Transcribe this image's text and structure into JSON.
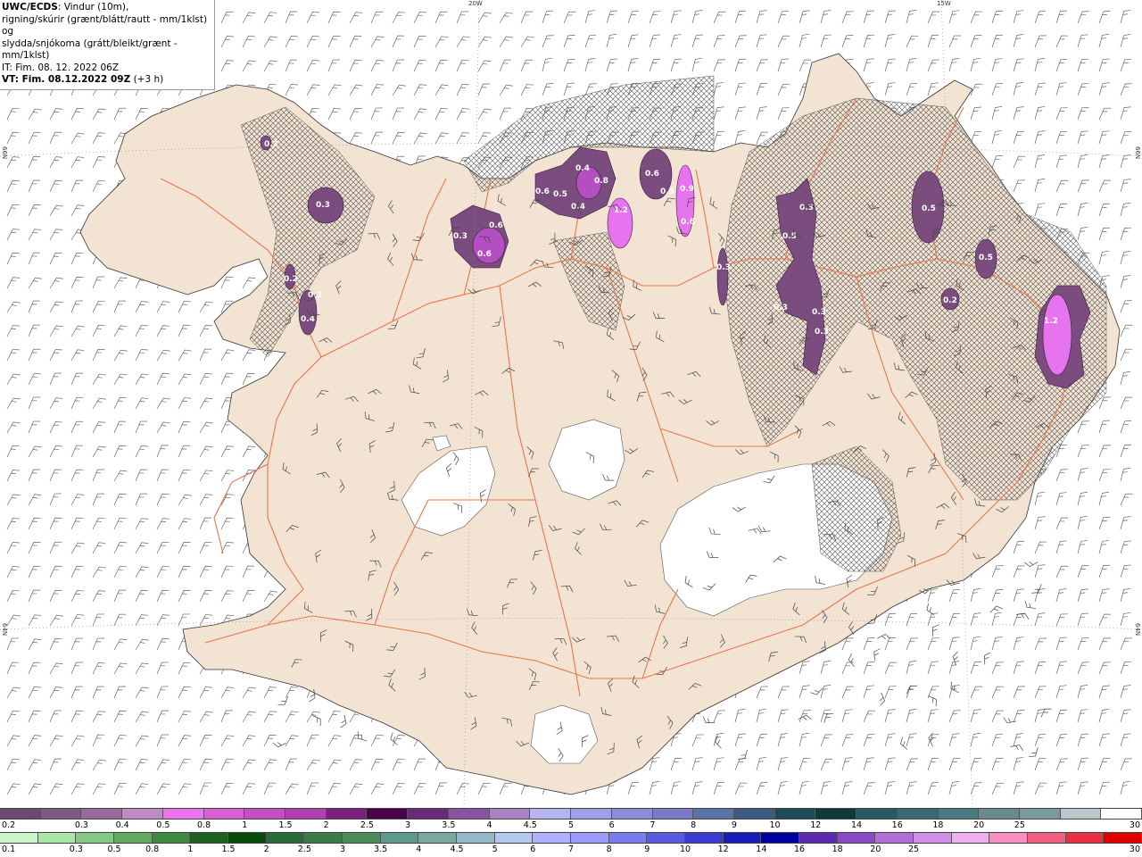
{
  "header": {
    "source": "UWC/ECDS",
    "line1": ": Vindur (10m),",
    "line2": "rigning/skúrir (grænt/blátt/rautt - mm/1klst) og",
    "line3": "slydda/snjókoma (grátt/bleikt/grænt - mm/1klst)",
    "issue_time": "IT: Fim. 08. 12. 2022 06Z",
    "valid_time": "VT: Fim. 08.12.2022 09Z",
    "lead": " (+3 h)"
  },
  "graticule": {
    "top_left": "20W",
    "top_right": "15W",
    "left_upper": "66N",
    "left_lower": "64N",
    "right_upper": "66N",
    "right_lower": "64N"
  },
  "precip_labels": [
    {
      "text": "0.3"
    },
    {
      "text": "0.3"
    },
    {
      "text": "0.2"
    },
    {
      "text": "0.3"
    },
    {
      "text": "0.4"
    },
    {
      "text": "0.3"
    },
    {
      "text": "0.6"
    },
    {
      "text": "0.6"
    },
    {
      "text": "0.6"
    },
    {
      "text": "0.5"
    },
    {
      "text": "0.4"
    },
    {
      "text": "0.8"
    },
    {
      "text": "0.4"
    },
    {
      "text": "1.2"
    },
    {
      "text": "0.6"
    },
    {
      "text": "0.5"
    },
    {
      "text": "0.9"
    },
    {
      "text": "0.6"
    },
    {
      "text": "0.3"
    },
    {
      "text": "0.3"
    },
    {
      "text": "0.5"
    },
    {
      "text": "0.3"
    },
    {
      "text": "0.3"
    },
    {
      "text": "0.3"
    },
    {
      "text": "0.5"
    },
    {
      "text": "0.5"
    },
    {
      "text": "0.2"
    },
    {
      "text": "1.2"
    }
  ],
  "colors": {
    "land": "#f3e3d3",
    "glacier": "#ffffff",
    "road": "#e8764a",
    "hatch": "#555555",
    "precip_light": "#7a4d7e",
    "precip_mid": "#b34fc0",
    "precip_high": "#e774ef"
  },
  "snow_scale": {
    "colors": [
      "#6a4a6e",
      "#7d5a82",
      "#9a6a9c",
      "#c18ac6",
      "#ed74ef",
      "#d95fd7",
      "#c44fc3",
      "#b040b0",
      "#7a1f7a",
      "#4a004a",
      "#6a2a7a",
      "#8a52a0",
      "#a882c2",
      "#b5b5f0",
      "#a0a0e8",
      "#8c8cd8",
      "#7a7ac8",
      "#5a72a8",
      "#3d5a82",
      "#1f4a5a",
      "#0f3a3a",
      "#285a60",
      "#3a6a70",
      "#4a7a80",
      "#6a8a90",
      "#7a9aa0",
      "#bdc6c8",
      "#ffffff"
    ],
    "labels": [
      "0.2",
      "0.3",
      "0.4",
      "0.5",
      "0.8",
      "1",
      "1.5",
      "2",
      "2.5",
      "3",
      "3.5",
      "4",
      "4.5",
      "5",
      "6",
      "7",
      "8",
      "9",
      "10",
      "12",
      "14",
      "16",
      "18",
      "20",
      "25",
      "30"
    ]
  },
  "rain_scale": {
    "colors": [
      "#c9f5c9",
      "#a8e6a8",
      "#86c686",
      "#62a962",
      "#3f8a3f",
      "#1f5f1f",
      "#0a4a0a",
      "#2a6a3a",
      "#3d7a4a",
      "#4d8a5a",
      "#5e9a8a",
      "#7aa8a0",
      "#95b8c8",
      "#b5c8f0",
      "#b0b0ff",
      "#9a9aff",
      "#7a7af0",
      "#5a5ae0",
      "#3a3ad0",
      "#1a1ab8",
      "#0000a0",
      "#5a2ab0",
      "#8a4ac8",
      "#b070d8",
      "#d090e8",
      "#f0b0f0",
      "#f590c0",
      "#ef6080",
      "#e83040",
      "#e00000"
    ],
    "labels": [
      "0.1",
      "0.3",
      "0.5",
      "0.8",
      "1",
      "1.5",
      "2",
      "2.5",
      "3",
      "3.5",
      "4",
      "4.5",
      "5",
      "6",
      "7",
      "8",
      "9",
      "10",
      "12",
      "14",
      "16",
      "18",
      "20",
      "25",
      "30"
    ]
  }
}
